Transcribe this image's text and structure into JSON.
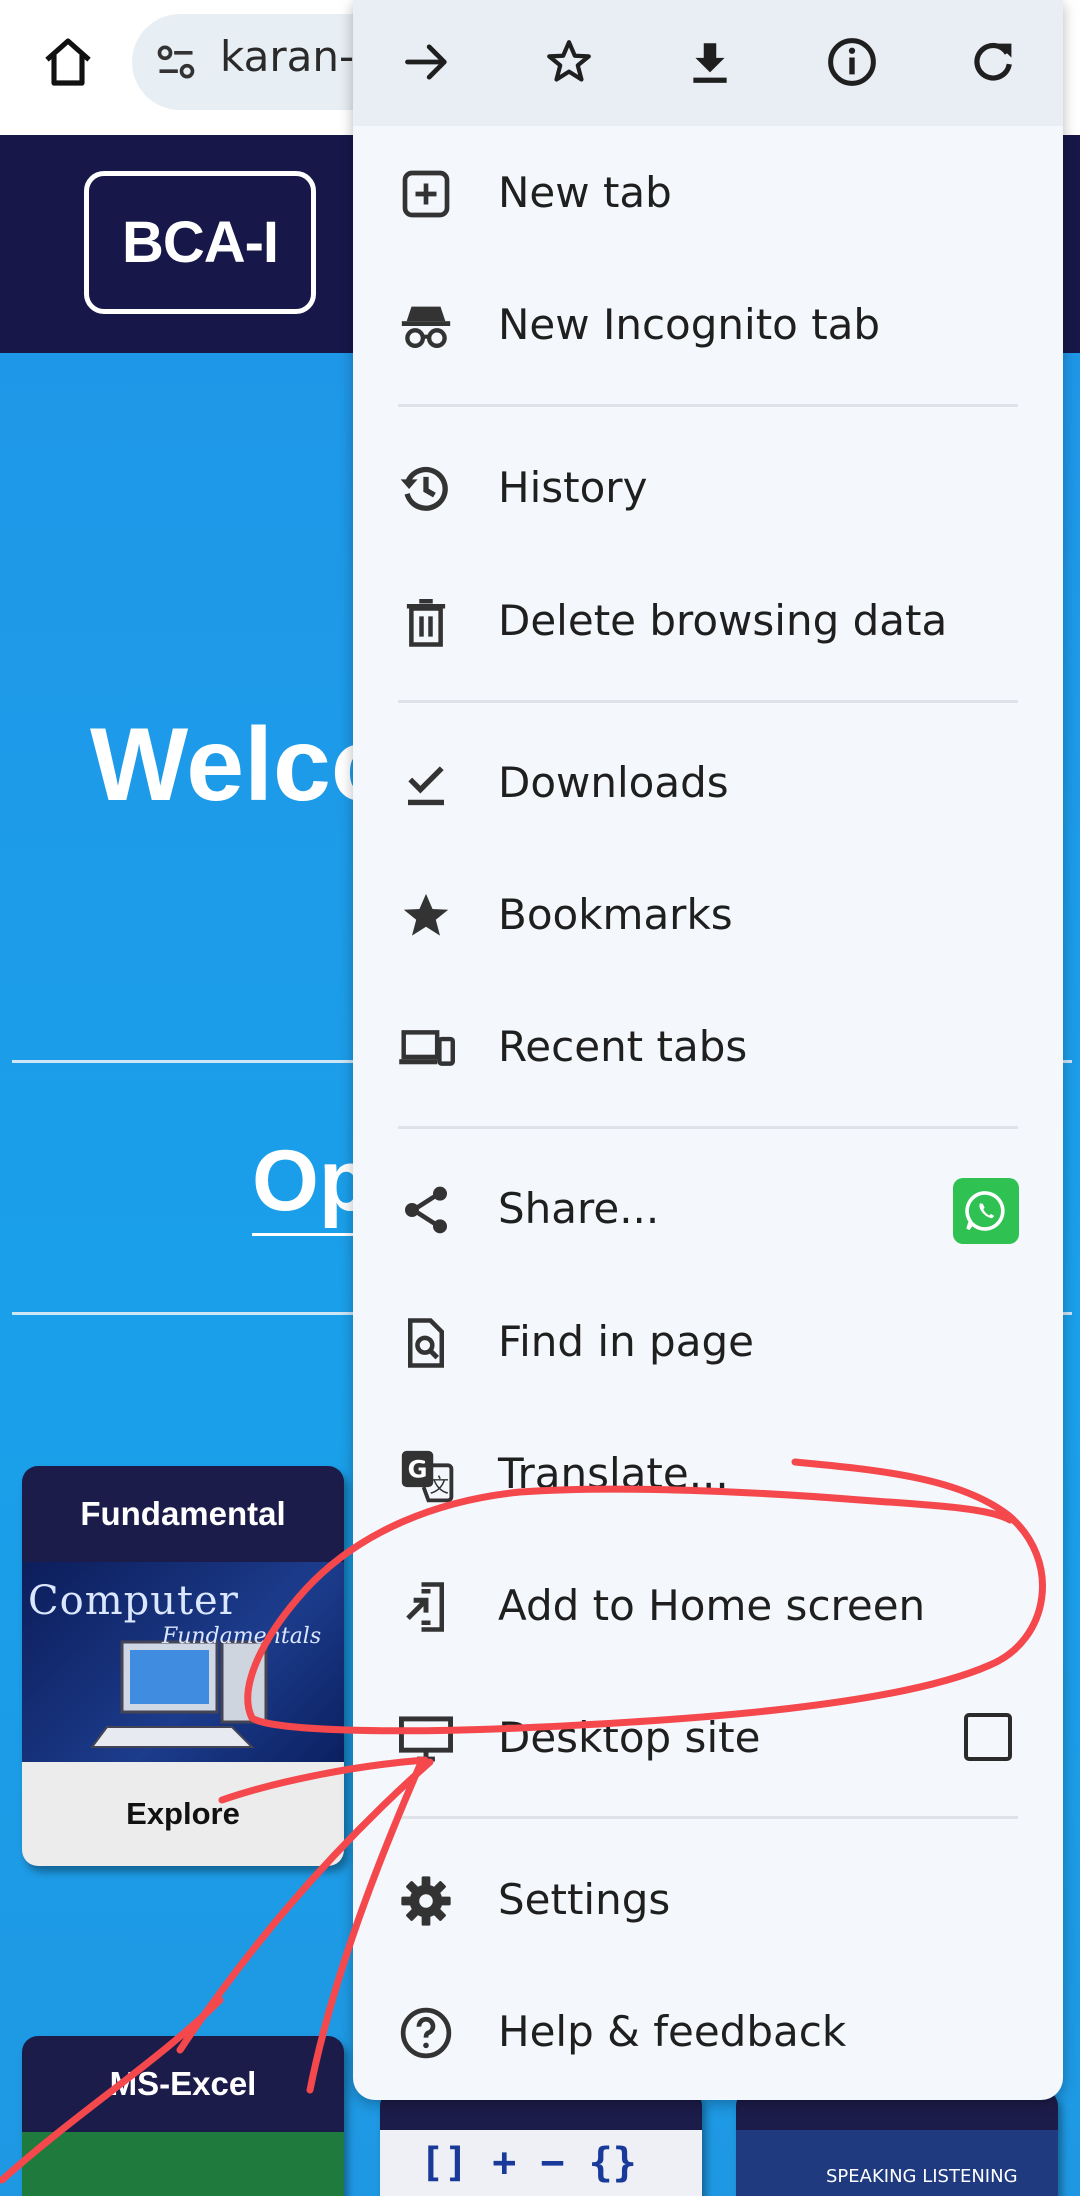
{
  "toolbar": {
    "url": "karan-",
    "icons": [
      "home-icon",
      "site-settings-icon"
    ]
  },
  "website": {
    "logo": "BCA-I",
    "welcome": "Welco",
    "options_heading": "Op",
    "cards": [
      {
        "title": "Fundamental",
        "image_text": "Computer",
        "image_subtext": "Fundamentals",
        "button": "Explore"
      },
      {
        "title": "MS-Excel"
      },
      {
        "image_text": "[] + − {}"
      },
      {
        "image_text": "SPEAKING LISTENING"
      }
    ]
  },
  "menu": {
    "actions": [
      {
        "name": "forward-icon"
      },
      {
        "name": "bookmark-star-icon"
      },
      {
        "name": "download-icon"
      },
      {
        "name": "page-info-icon"
      },
      {
        "name": "refresh-icon"
      }
    ],
    "items": [
      {
        "label": "New tab",
        "icon": "new-tab-icon"
      },
      {
        "label": "New Incognito tab",
        "icon": "incognito-icon"
      },
      {
        "label": "History",
        "icon": "history-icon"
      },
      {
        "label": "Delete browsing data",
        "icon": "trash-icon"
      },
      {
        "label": "Downloads",
        "icon": "downloads-check-icon"
      },
      {
        "label": "Bookmarks",
        "icon": "star-icon"
      },
      {
        "label": "Recent tabs",
        "icon": "devices-icon"
      },
      {
        "label": "Share...",
        "icon": "share-icon"
      },
      {
        "label": "Find in page",
        "icon": "find-in-page-icon"
      },
      {
        "label": "Translate...",
        "icon": "translate-icon"
      },
      {
        "label": "Add to Home screen",
        "icon": "add-to-home-icon"
      },
      {
        "label": "Desktop site",
        "icon": "desktop-icon"
      },
      {
        "label": "Settings",
        "icon": "gear-icon"
      },
      {
        "label": "Help & feedback",
        "icon": "help-icon"
      }
    ],
    "share_target": "whatsapp-icon",
    "desktop_site_checked": false
  },
  "colors": {
    "menu_bg": "#f4f7fc",
    "header_navy": "#17174a",
    "hero_blue": "#1c9ee6",
    "annotation_red": "#f4484c",
    "whatsapp_green": "#2fc253"
  }
}
